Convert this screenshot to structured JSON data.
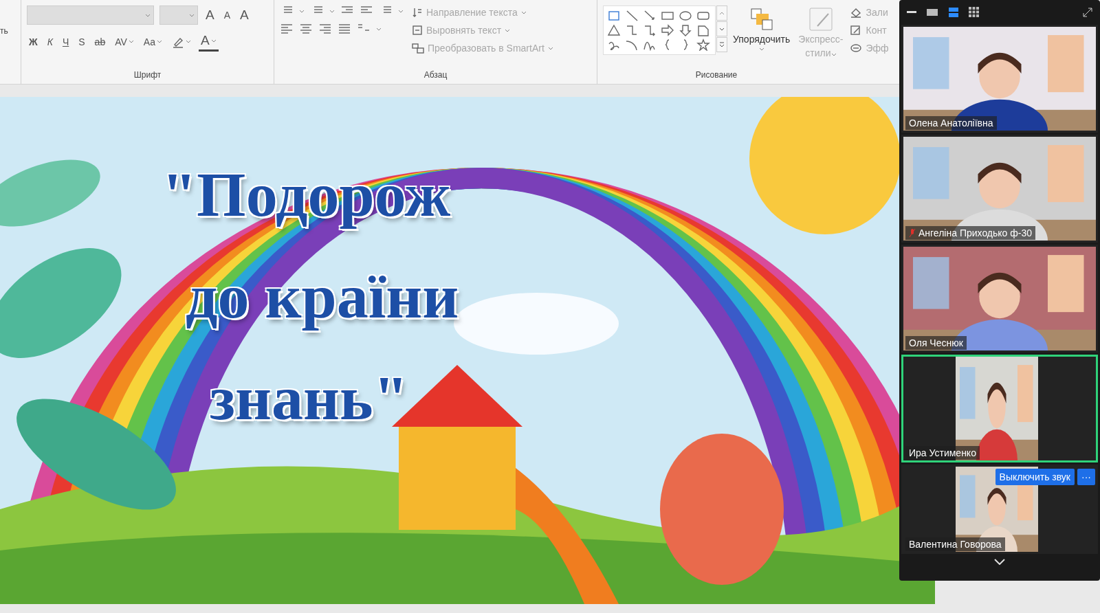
{
  "ribbon": {
    "cut_label": "ть",
    "font_group": {
      "label": "Шрифт",
      "font_field": {
        "disabled": true
      },
      "size_field": {
        "disabled": true
      },
      "row1": [
        {
          "kind": "grow",
          "text": "A"
        },
        {
          "kind": "shrink",
          "text": "A"
        },
        {
          "kind": "clear",
          "text": "A"
        }
      ],
      "row2": [
        {
          "kind": "bold",
          "text": "Ж"
        },
        {
          "kind": "italic",
          "text": "К"
        },
        {
          "kind": "underline",
          "text": "Ч"
        },
        {
          "kind": "shadow",
          "text": "S"
        },
        {
          "kind": "strike",
          "text": "ab"
        },
        {
          "kind": "spacing",
          "text": "AV"
        },
        {
          "kind": "case",
          "text": "Aa"
        },
        {
          "kind": "highlight"
        },
        {
          "kind": "color",
          "text": "A"
        }
      ]
    },
    "paragraph_group": {
      "label": "Абзац",
      "commands": [
        {
          "text": "Направление текста",
          "kind": "direction",
          "disabled": true
        },
        {
          "text": "Выровнять текст",
          "kind": "align",
          "disabled": true
        },
        {
          "text": "Преобразовать в SmartArt",
          "kind": "smartart",
          "disabled": true
        }
      ]
    },
    "drawing_group": {
      "label": "Рисование",
      "arrange": {
        "text": "Упорядочить",
        "disabled": false
      },
      "styles": {
        "lines": [
          "Экспресс-",
          "стили"
        ],
        "disabled": true
      },
      "commands": [
        {
          "text": "Зали",
          "kind": "fill",
          "disabled": true
        },
        {
          "text": "Конт",
          "kind": "outline",
          "disabled": true
        },
        {
          "text": "Эфф",
          "kind": "effects",
          "disabled": true
        }
      ]
    }
  },
  "slide": {
    "title_lines": [
      "\"Подорож",
      "до країни",
      "знань\""
    ],
    "kind": "picture"
  },
  "zoom": {
    "view_modes": [
      {
        "kind": "single",
        "selected": false
      },
      {
        "kind": "speaker",
        "selected": true
      },
      {
        "kind": "gallery",
        "selected": false
      }
    ],
    "tiles": [
      {
        "name": "Олена Анатоліївна",
        "muted": false,
        "active": false,
        "kind": "wide"
      },
      {
        "name": "Ангеліна Приходько ф-30",
        "muted": true,
        "active": false,
        "kind": "wide"
      },
      {
        "name": "Оля Чеснюк",
        "muted": false,
        "active": false,
        "kind": "wide"
      },
      {
        "name": "Ира Устименко",
        "muted": false,
        "active": true,
        "kind": "narrow"
      },
      {
        "name": "Валентина Говорова",
        "muted": false,
        "active": false,
        "kind": "narrow",
        "buttons": [
          "Выключить звук",
          "···"
        ]
      }
    ]
  }
}
